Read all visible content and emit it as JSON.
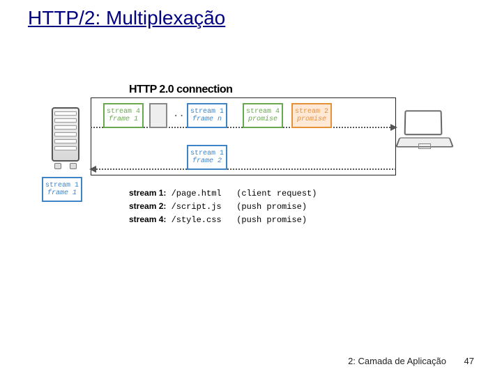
{
  "title": "HTTP/2: Multiplexação",
  "conn_label": "HTTP 2.0 connection",
  "frames": {
    "s4f1": {
      "l1": "stream 4",
      "l2": "frame 1"
    },
    "gray": {
      "l1": "",
      "l2": ""
    },
    "s1fn": {
      "l1": "stream 1",
      "l2": "frame n"
    },
    "s4p": {
      "l1": "stream 4",
      "l2": "promise"
    },
    "s2p": {
      "l1": "stream 2",
      "l2": "promise"
    },
    "s1f2": {
      "l1": "stream 1",
      "l2": "frame 2"
    },
    "s1f1": {
      "l1": "stream 1",
      "l2": "frame 1"
    }
  },
  "ellipsis": "...",
  "streams": {
    "r1": {
      "label": "stream 1:",
      "path": "/page.html",
      "note": "(client request)"
    },
    "r2": {
      "label": "stream 2:",
      "path": "/script.js",
      "note": "(push promise)"
    },
    "r3": {
      "label": "stream 4:",
      "path": "/style.css",
      "note": "(push promise)"
    }
  },
  "footer": {
    "chapter": "2: Camada de Aplicação",
    "page": "47"
  }
}
